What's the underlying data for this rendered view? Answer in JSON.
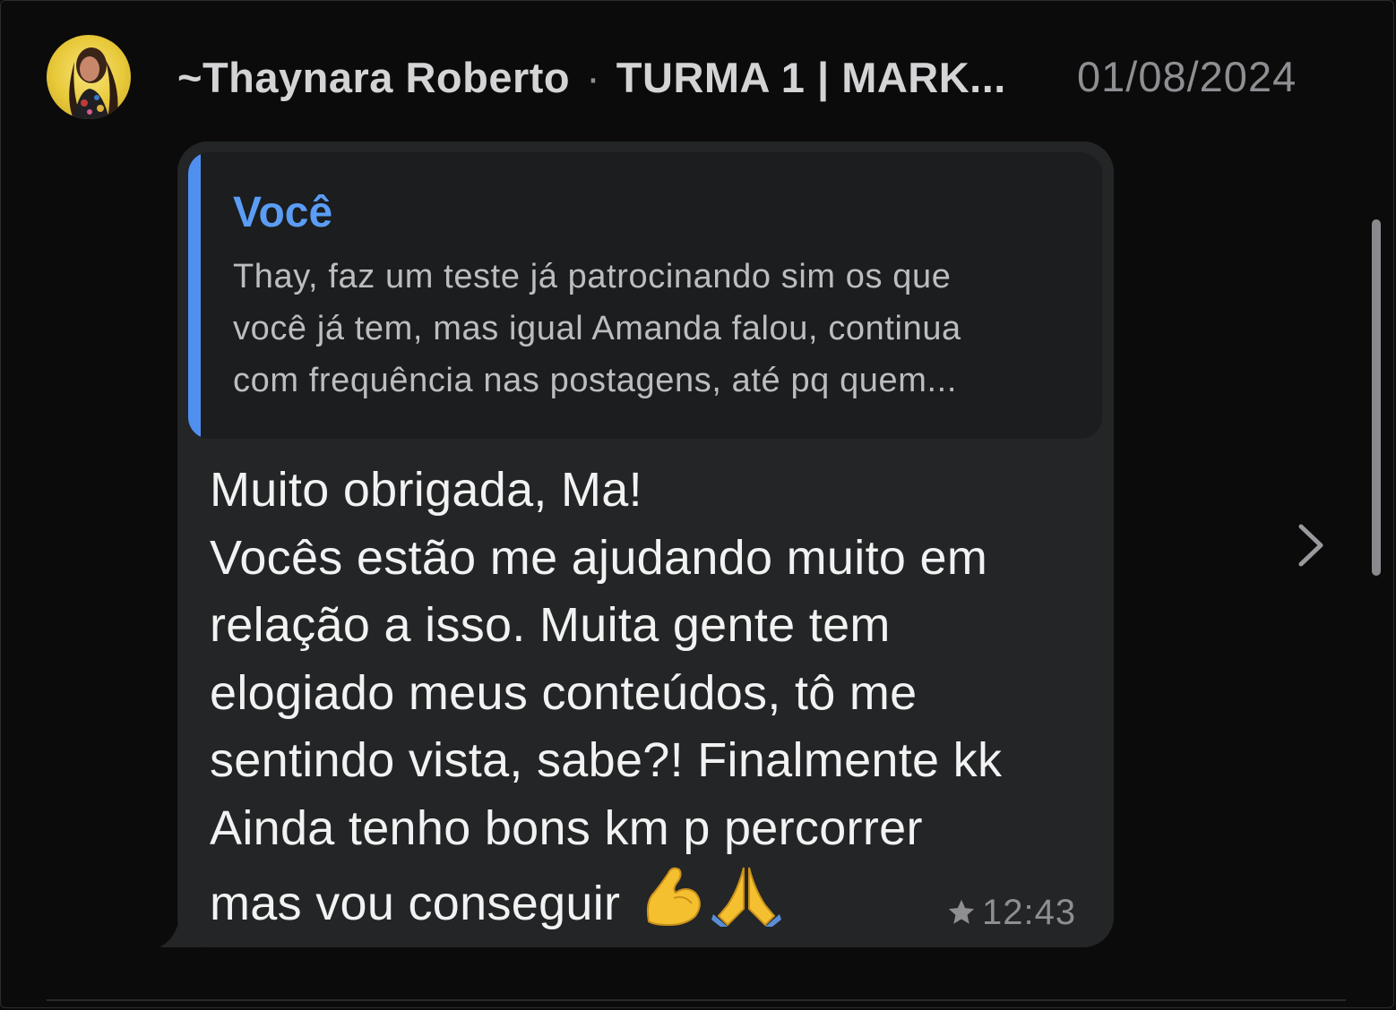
{
  "header": {
    "sender": "~Thaynara Roberto",
    "separator": "·",
    "group": "TURMA 1 | MARK...",
    "date": "01/08/2024"
  },
  "quote": {
    "author": "Você",
    "lines": [
      "Thay, faz um teste já patrocinando sim os que",
      "você já tem, mas igual Amanda falou, continua",
      "com frequência nas postagens, até pq quem..."
    ]
  },
  "message": {
    "lines": [
      "Muito obrigada, Ma!",
      "Vocês estão me ajudando muito em",
      "relação a isso. Muita gente tem",
      "elogiado meus conteúdos, tô me",
      "sentindo vista, sabe?! Finalmente kk",
      "Ainda tenho bons km p percorrer",
      "mas vou conseguir"
    ],
    "emojis": [
      "💪",
      "🙏"
    ],
    "time": "12:43",
    "starred": true
  },
  "icons": {
    "star": "star-icon",
    "chevron": "chevron-right-icon",
    "flexed_biceps": "flexed-biceps-emoji",
    "folded_hands": "folded-hands-emoji"
  },
  "colors": {
    "background": "#0b0b0b",
    "bubble": "#232526",
    "quote_background": "#1b1d1e",
    "accent_blue": "#4f8ff0",
    "muted_text": "#8e8e93"
  }
}
